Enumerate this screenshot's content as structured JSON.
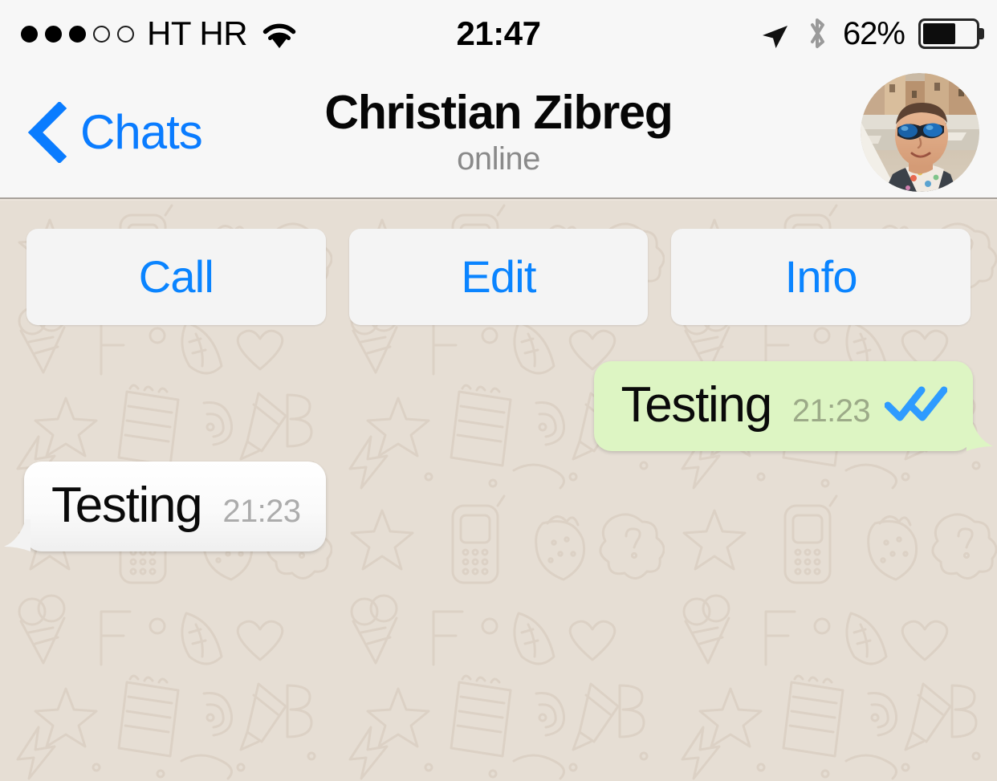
{
  "status_bar": {
    "signal_dots_filled": 3,
    "signal_dots_total": 5,
    "carrier": "HT HR",
    "wifi_icon": "wifi-icon",
    "time": "21:47",
    "location_icon": "location-arrow-icon",
    "bluetooth_icon": "bluetooth-icon",
    "battery_percent_label": "62%",
    "battery_level": 62
  },
  "nav_bar": {
    "back_label": "Chats",
    "back_icon": "chevron-left-icon",
    "title": "Christian Zibreg",
    "subtitle": "online",
    "avatar_alt": "contact-avatar"
  },
  "actions": [
    {
      "label": "Call",
      "name": "call-button"
    },
    {
      "label": "Edit",
      "name": "edit-button"
    },
    {
      "label": "Info",
      "name": "info-button"
    }
  ],
  "messages": [
    {
      "direction": "outgoing",
      "text": "Testing",
      "time": "21:23",
      "status_icon": "double-check-icon",
      "read": true
    },
    {
      "direction": "incoming",
      "text": "Testing",
      "time": "21:23",
      "status_icon": null,
      "read": false
    }
  ],
  "colors": {
    "status_bar_bg": "#F7F7F7",
    "nav_bar_bg": "#F7F7F7",
    "accent_blue": "#0A7CFF",
    "action_button_bg": "#F4F4F4",
    "chat_background": "#E3DBD0",
    "outgoing_bubble": "#DDF5C3",
    "incoming_bubble": "#FFFFFF",
    "read_receipt_blue": "#2E9BFF",
    "outgoing_time": "#9CAA88",
    "incoming_time": "#ACACAC",
    "subtitle_gray": "#8A8A8A"
  }
}
